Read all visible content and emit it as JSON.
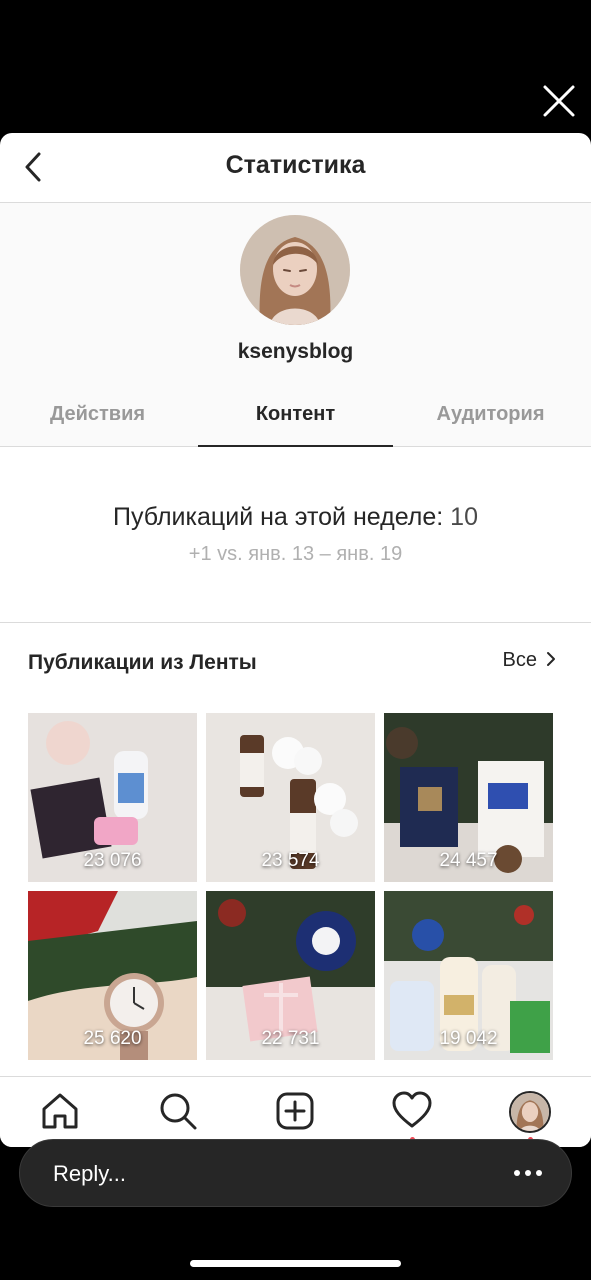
{
  "header": {
    "title": "Статистика"
  },
  "profile": {
    "username": "ksenysblog"
  },
  "tabs": [
    {
      "label": "Действия",
      "active": false
    },
    {
      "label": "Контент",
      "active": true
    },
    {
      "label": "Аудитория",
      "active": false
    }
  ],
  "summary": {
    "label": "Публикаций на этой неделе:",
    "value": "10",
    "comparison": "+1 vs. янв. 13 – янв. 19"
  },
  "feed": {
    "title": "Публикации из Ленты",
    "see_all": "Все",
    "posts": [
      {
        "reach": "23 076"
      },
      {
        "reach": "23 574"
      },
      {
        "reach": "24 457"
      },
      {
        "reach": "25 620"
      },
      {
        "reach": "22 731"
      },
      {
        "reach": "19 042"
      }
    ]
  },
  "bottom_nav": {
    "items": [
      "home-icon",
      "search-icon",
      "add-post-icon",
      "heart-icon",
      "profile-avatar"
    ],
    "notification_color": "#ed4956"
  },
  "reply": {
    "placeholder": "Reply..."
  },
  "colors": {
    "text": "#262626",
    "muted": "#999999",
    "divider": "#dbdbdb",
    "accent": "#ed4956"
  }
}
